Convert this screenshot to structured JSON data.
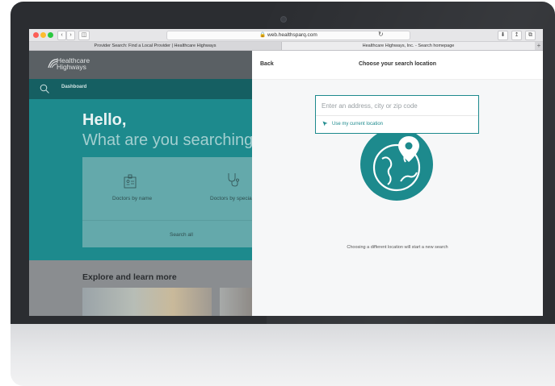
{
  "browser": {
    "url": "web.healthsparq.com",
    "tabs": [
      {
        "label": "Provider Search: Find a Local Provider | Healthcare Highways"
      },
      {
        "label": "Healthcare Highways, Inc. - Search homepage"
      }
    ],
    "new_tab_symbol": "+"
  },
  "site": {
    "logo_line1": "Healthcare",
    "logo_line2": "Highways",
    "nav_label": "Dashboard",
    "hello": "Hello,",
    "hero_sub": "What are you searching f",
    "card": {
      "option1": "Doctors by name",
      "option2": "Doctors by specia",
      "search_all": "Search all"
    },
    "explore_title": "Explore and learn more"
  },
  "drawer": {
    "back": "Back",
    "title": "Choose your search location",
    "input_placeholder": "Enter an address, city or zip code",
    "use_location": "Use my current location",
    "notice": "Choosing a different location will start a new search"
  },
  "colors": {
    "accent": "#1d8a8d",
    "nav": "#155f62",
    "header": "#5a6064"
  },
  "icons": [
    "search-icon",
    "id-card-icon",
    "stethoscope-icon",
    "location-arrow-icon",
    "globe-pin-icon",
    "sidebar-icon",
    "share-icon",
    "download-icon"
  ]
}
